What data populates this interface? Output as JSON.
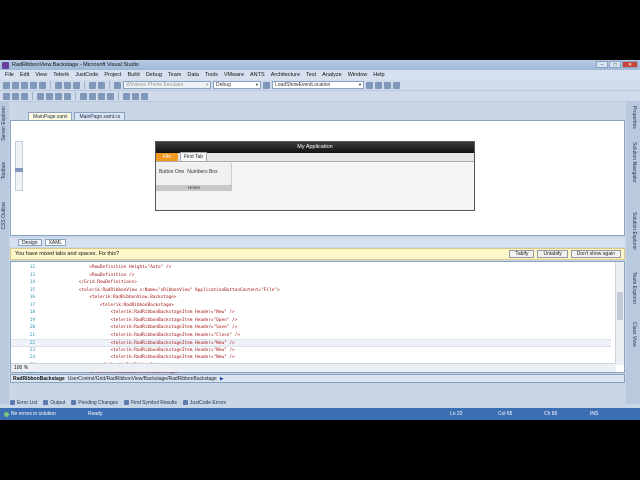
{
  "window": {
    "title": "RadRibbonView.Backstage - Microsoft Visual Studio",
    "controls": {
      "minimize": "–",
      "maximize": "□",
      "close": "✕"
    }
  },
  "menu": [
    "File",
    "Edit",
    "View",
    "Telerik",
    "JustCode",
    "Project",
    "Build",
    "Debug",
    "Team",
    "Data",
    "Tools",
    "VMware",
    "ANTS",
    "Architecture",
    "Test",
    "Analyze",
    "Window",
    "Help"
  ],
  "toolbar": {
    "emulator": "Windows Phone Emulator",
    "config": "Debug",
    "find": "LoadShowEventLocation"
  },
  "left_tabs": [
    "Server Explorer",
    "Toolbox",
    "CSS Outline"
  ],
  "right_tabs": [
    "Properties",
    "Solution Navigator",
    "Solution Explorer",
    "Team Explorer",
    "Class View"
  ],
  "doc_tabs": [
    {
      "label": "MainPage.xaml",
      "active": true
    },
    {
      "label": "MainPage.xaml.cs",
      "active": false
    }
  ],
  "designer": {
    "app_title": "My Application",
    "file_tab": "File",
    "first_tab": "First Tab",
    "button_one": "Button One",
    "numbers_box": "Numbers Box",
    "group_label": "Home"
  },
  "view_switch": {
    "design": "Design",
    "xaml": "XAML"
  },
  "infobar": {
    "message": "You have mixed tabs and spaces. Fix this?",
    "tabify": "Tabify",
    "untabify": "Untabify",
    "dont_show": "Don't show again"
  },
  "code_lines": [
    {
      "num": "12",
      "text": "                <RowDefinition Height=\"Auto\" />"
    },
    {
      "num": "13",
      "text": "                <RowDefinition />"
    },
    {
      "num": "14",
      "text": "            </Grid.RowDefinitions>"
    },
    {
      "num": "15",
      "text": "            <telerik:RadRibbonView x:Name=\"xRibbonView\" ApplicationButtonContent=\"File\">"
    },
    {
      "num": "16",
      "text": "                <telerik:RadRibbonView.Backstage>"
    },
    {
      "num": "17",
      "text": "                    <telerik:RadRibbonBackstage>"
    },
    {
      "num": "18",
      "text": "                        <telerik:RadRibbonBackstageItem Header=\"New\" />"
    },
    {
      "num": "19",
      "text": "                        <telerik:RadRibbonBackstageItem Header=\"Open\" />"
    },
    {
      "num": "20",
      "text": "                        <telerik:RadRibbonBackstageItem Header=\"Save\" />"
    },
    {
      "num": "21",
      "text": "                        <telerik:RadRibbonBackstageItem Header=\"Close\" />"
    },
    {
      "num": "22",
      "text": "                        <telerik:RadRibbonBackstageItem Header=\"New\" />"
    },
    {
      "num": "23",
      "text": "                        <telerik:RadRibbonBackstageItem Header=\"New\" />"
    },
    {
      "num": "24",
      "text": "                        <telerik:RadRibbonBackstageItem Header=\"New\" />"
    },
    {
      "num": "25",
      "text": "                    </telerik:RadRibbonBackstage>"
    },
    {
      "num": "26",
      "text": "                </telerik:RadRibbonView.Backstage>"
    }
  ],
  "editor": {
    "zoom": "100 %"
  },
  "breadcrumb": {
    "current": "RadRibbonBackstage",
    "path": "UserControl/Grid/RadRibbonView/Backstage/RadRibbonBackstage"
  },
  "bottom_tabs": [
    "Error List",
    "Output",
    "Pending Changes",
    "Find Symbol Results",
    "JustCode Errors"
  ],
  "status": {
    "errors": "No errors in solution",
    "ready": "Ready",
    "ln": "Ln 22",
    "col": "Col 65",
    "ch": "Ch 65",
    "ins": "INS"
  },
  "colors": {
    "statusbar": "#3c6eb4",
    "file_tab": "#f29a1f",
    "infobar": "#fdf6c9"
  }
}
